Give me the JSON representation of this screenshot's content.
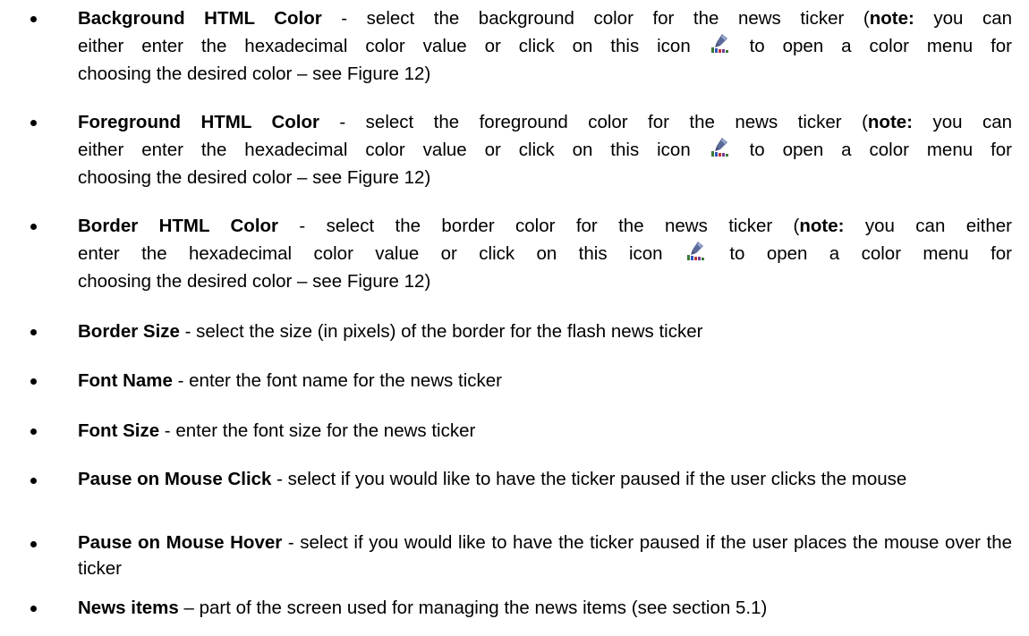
{
  "items": [
    {
      "term": "Background HTML Color",
      "line1_rest": " - select the background color for the news ticker (",
      "note_label": "note:",
      "line1_tail": " you can",
      "line2_before_icon": "either enter the hexadecimal color value or click on this icon",
      "line2_after_icon": " to open a color menu for",
      "line3": "choosing the desired color – see Figure 12)",
      "icon": "color-picker-icon"
    },
    {
      "term": "Foreground HTML Color",
      "line1_rest": " - select the foreground color for the news ticker (",
      "note_label": "note:",
      "line1_tail": " you can",
      "line2_before_icon": "either enter the hexadecimal color value or click on this icon",
      "line2_after_icon": " to open a color menu for",
      "line3": "choosing the desired color – see Figure 12)",
      "icon": "color-picker-icon"
    },
    {
      "term": "Border HTML Color",
      "line1_rest": " - select the border color for the news ticker (",
      "note_label": "note:",
      "line1_tail": " you can either",
      "line2_before_icon": "enter the hexadecimal color value or click on this icon",
      "line2_after_icon": " to open a color menu for",
      "line3": "choosing the desired color – see Figure 12)",
      "icon": "color-picker-icon"
    },
    {
      "term": "Border Size",
      "desc": " - select the size (in pixels) of the border for the flash news ticker"
    },
    {
      "term": "Font Name",
      "desc": " - enter the font name for the news ticker"
    },
    {
      "term": "Font Size",
      "desc": " - enter the font size for the news ticker"
    },
    {
      "term": "Pause on Mouse Click",
      "desc": " - select if you would like to have the ticker paused if the user clicks the mouse"
    },
    {
      "term": "Pause on Mouse Hover",
      "desc": " - select if you would like to have the ticker paused if the user places the mouse over the ticker"
    },
    {
      "term": "News items",
      "desc": " – part of the screen used for managing the news items (see section 5.1)"
    }
  ]
}
